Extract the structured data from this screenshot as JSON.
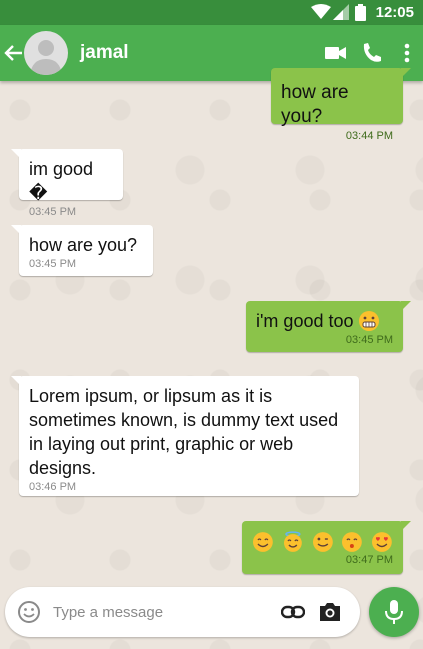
{
  "status_bar": {
    "time": "12:05"
  },
  "header": {
    "contact_name": "jamal"
  },
  "messages": [
    {
      "direction": "out",
      "text": "how are you?",
      "time": "03:44 PM"
    },
    {
      "direction": "in",
      "text": "im good �",
      "time": "03:45 PM"
    },
    {
      "direction": "in",
      "text": "how are you?",
      "time": "03:45 PM"
    },
    {
      "direction": "out",
      "text": "i'm good too",
      "emoji": "grin-emoji",
      "time": "03:45 PM"
    },
    {
      "direction": "in",
      "text": "Lorem ipsum, or lipsum as it is sometimes known, is dummy text used in laying out print, graphic or web designs.",
      "time": "03:46 PM"
    },
    {
      "direction": "out",
      "emoji": [
        "smile-emoji",
        "halo-emoji",
        "wink-emoji",
        "kiss-emoji",
        "heart-eyes-emoji"
      ],
      "time": "03:47 PM"
    }
  ],
  "composer": {
    "placeholder": "Type a message"
  },
  "icons": {
    "back": "arrow-back-icon",
    "call_video": "video-call-icon",
    "call_voice": "phone-icon",
    "more": "more-vert-icon",
    "emoji": "emoji-icon",
    "attach": "attach-link-icon",
    "camera": "camera-icon",
    "mic": "mic-icon"
  },
  "colors": {
    "app_bar": "#4caf50",
    "status_bar": "#388e3c",
    "outgoing_bubble": "#8bc34a",
    "incoming_bubble": "#ffffff",
    "wallpaper": "#ece5dd"
  }
}
